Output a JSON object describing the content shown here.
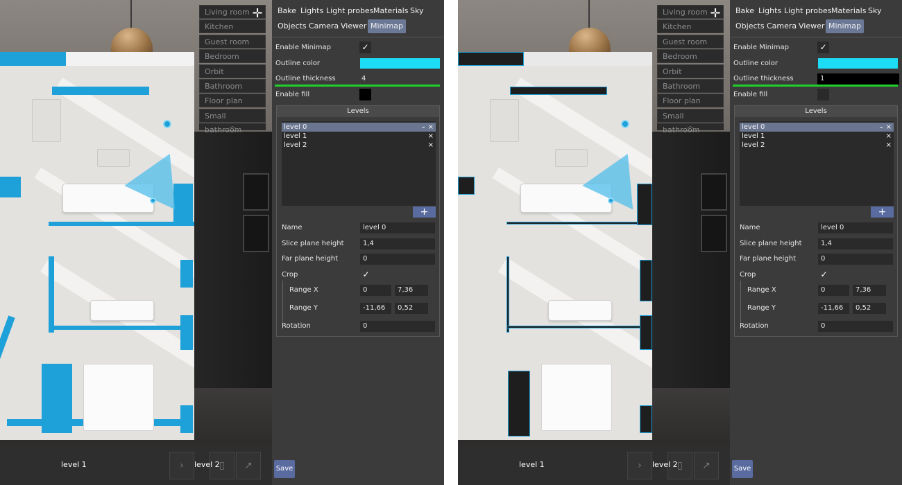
{
  "cameras": [
    "Living room",
    "Kitchen",
    "Guest room",
    "Bedroom",
    "Orbit",
    "Bathroom",
    "Floor plan",
    "Small bathroom"
  ],
  "tabs_row1": [
    "Bake",
    "Lights",
    "Light probes",
    "Materials",
    "Sky"
  ],
  "tabs_row2": [
    "Objects",
    "Camera",
    "Viewer",
    "Minimap"
  ],
  "active_tab": "Minimap",
  "bottom_levels": [
    "level 1",
    "level 2"
  ],
  "labels": {
    "enable_minimap": "Enable Minimap",
    "outline_color": "Outline color",
    "outline_thickness": "Outline thickness",
    "enable_fill": "Enable fill",
    "levels": "Levels",
    "name": "Name",
    "slice_plane_height": "Slice plane height",
    "far_plane_height": "Far plane height",
    "crop": "Crop",
    "range_x": "Range X",
    "range_y": "Range Y",
    "rotation": "Rotation",
    "save": "Save",
    "add": "+",
    "remove": "×",
    "check": "✓"
  },
  "levels_list": [
    "level 0",
    "level 1",
    "level 2"
  ],
  "selected_level": "level 0",
  "panels": [
    {
      "outline_color": "#1ddcf5",
      "outline_thickness": "4",
      "enable_fill_color": "#000000",
      "name": "level 0",
      "slice_plane_height": "1,4",
      "far_plane_height": "0",
      "range_x_min": "0",
      "range_x_max": "7,36",
      "range_y_min": "-11,66",
      "range_y_max": "0,52",
      "rotation": "0"
    },
    {
      "outline_color": "#1ddcf5",
      "outline_thickness": "1",
      "enable_fill_color": "#2a2a2a",
      "name": "level 0",
      "slice_plane_height": "1,4",
      "far_plane_height": "0",
      "range_x_min": "0",
      "range_x_max": "7,36",
      "range_y_min": "-11,66",
      "range_y_max": "0,52",
      "rotation": "0"
    }
  ],
  "colors": {
    "panel_bg": "#3b3b3b",
    "accent_tab": "#6b7896",
    "wall_blue": "#1ea0d8",
    "green_bar": "#21d02b",
    "save_button": "#5a6ba0"
  }
}
